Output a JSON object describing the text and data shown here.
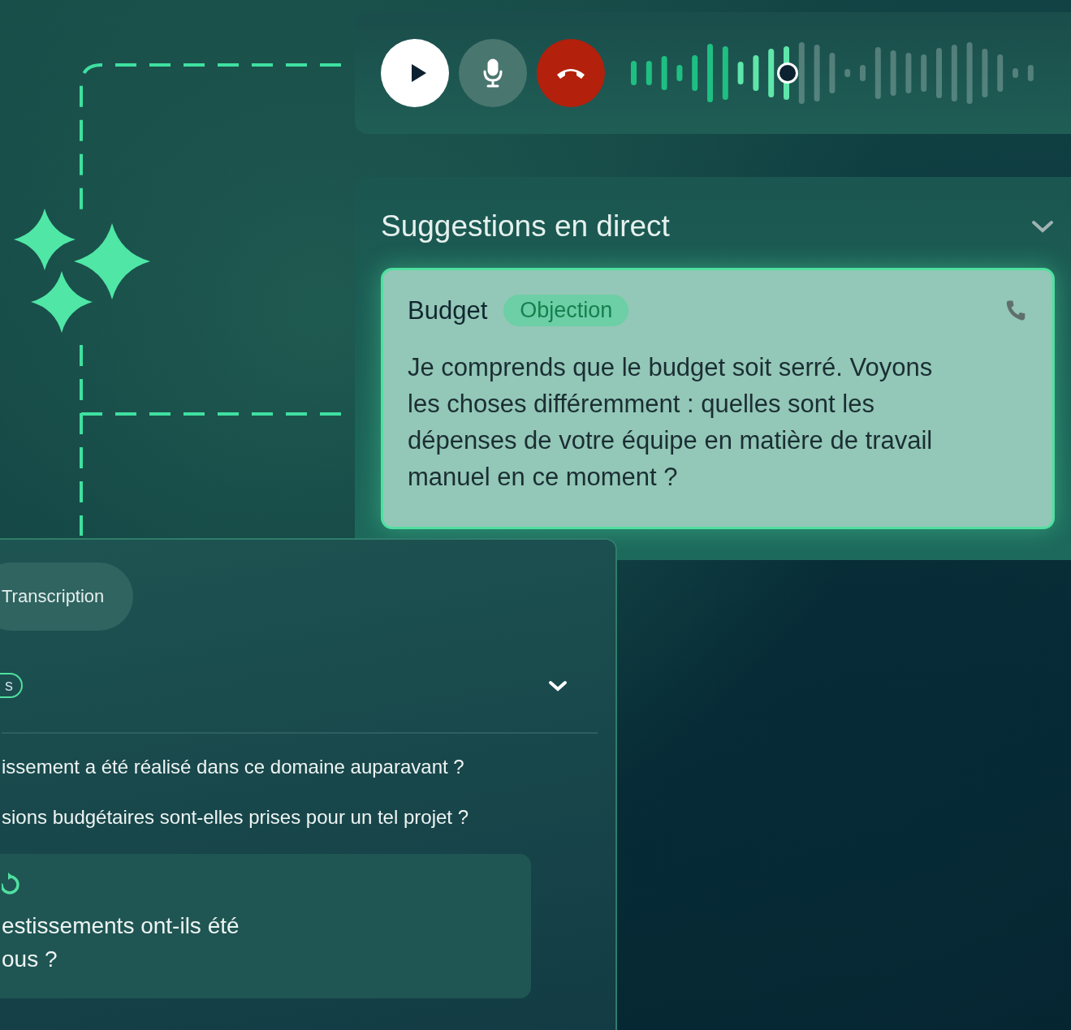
{
  "suggestions": {
    "title": "Suggestions en direct",
    "card": {
      "title": "Budget",
      "tag": "Objection",
      "text": "Je comprends que le budget soit serré. Voyons les choses différemment : quelles sont les dépenses de votre équipe en matière de travail manuel en ce moment ?"
    }
  },
  "transcript": {
    "tab": "Transcription",
    "tag": "s",
    "questions": [
      "issement a été réalisé dans ce domaine auparavant ?",
      "sions budgétaires sont-elles prises pour un tel projet ?"
    ],
    "card_lines": [
      "estissements ont-ils été",
      "ous ?"
    ]
  }
}
